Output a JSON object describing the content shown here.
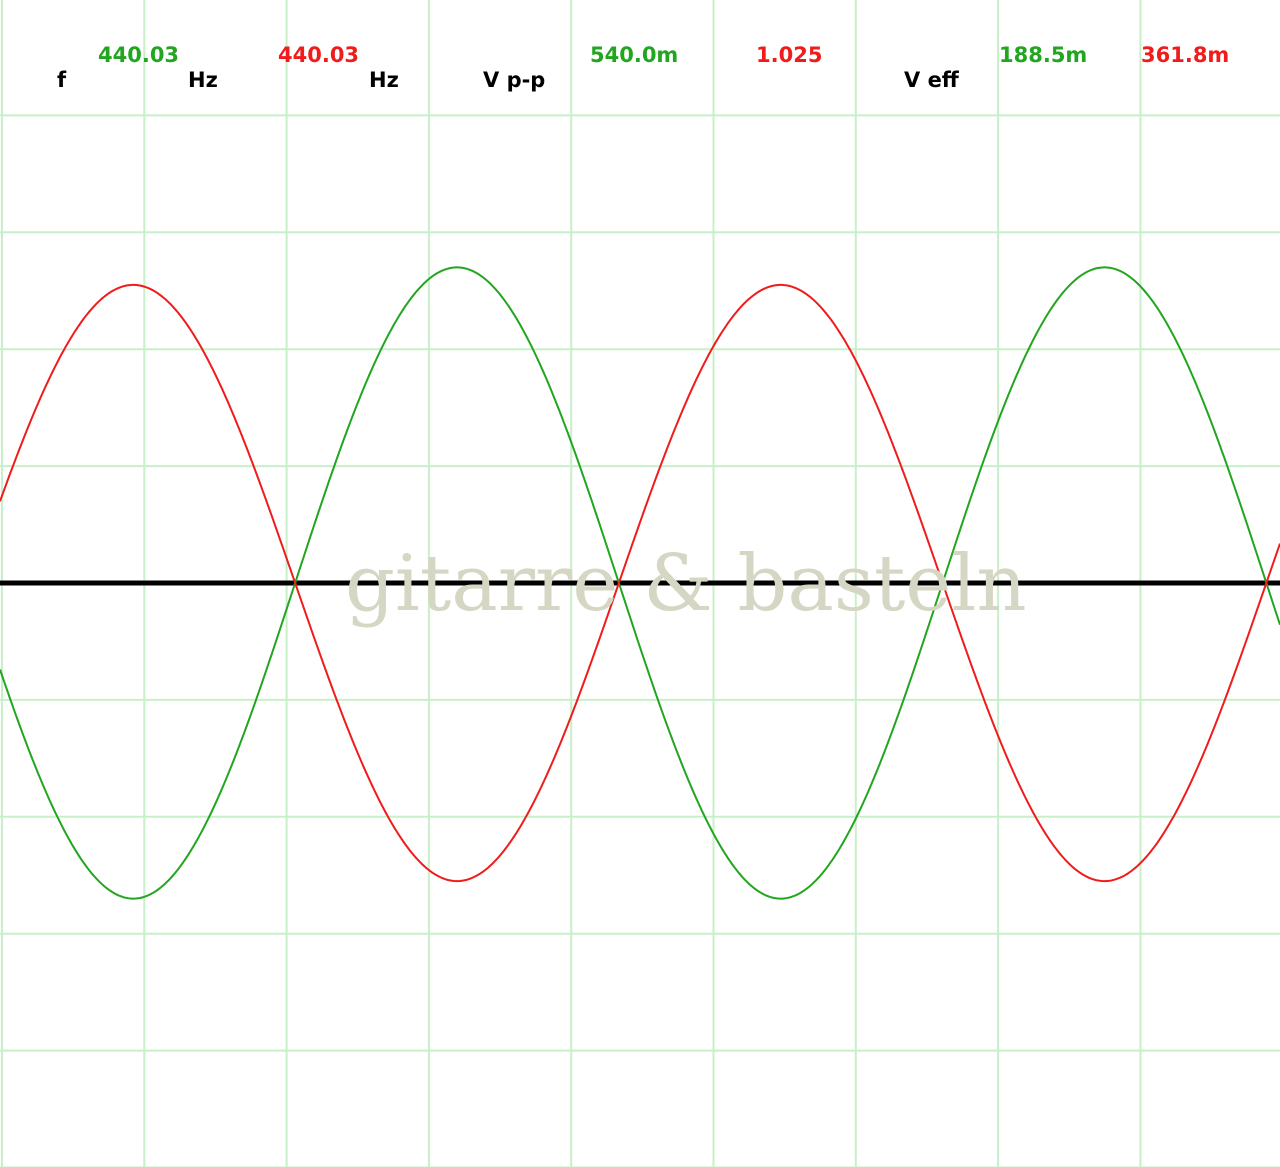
{
  "watermark": "gitarre & basteln",
  "readouts": {
    "freq": {
      "label": "f",
      "ch1_value": "440.03",
      "ch1_unit": "Hz",
      "ch2_value": "440.03",
      "ch2_unit": "Hz"
    },
    "vpp": {
      "label": "V p-p",
      "ch1_value": "540.0m",
      "ch2_value": "1.025"
    },
    "veff": {
      "label": "V eff",
      "ch1_value": "188.5m",
      "ch2_value": "361.8m"
    }
  },
  "colors": {
    "ch1": "#22a51f",
    "ch2": "#f01b1b",
    "label": "#000000",
    "grid": "#c8f0c8",
    "baseline": "#000000",
    "watermark": "#d6d6c4"
  },
  "chart_data": {
    "type": "line",
    "title": "",
    "xlabel": "",
    "ylabel": "",
    "grid": true,
    "x_divisions": 9,
    "y_divisions": 10,
    "xlim": [
      0,
      9
    ],
    "ylim": [
      -5,
      5
    ],
    "series": [
      {
        "color": "#22a51f",
        "amplitude": 2.7,
        "period": 4.55,
        "phase": 2.06,
        "invert": false
      },
      {
        "color": "#f01b1b",
        "amplitude": 2.55,
        "period": 4.55,
        "phase": 2.06,
        "invert": true
      }
    ]
  }
}
